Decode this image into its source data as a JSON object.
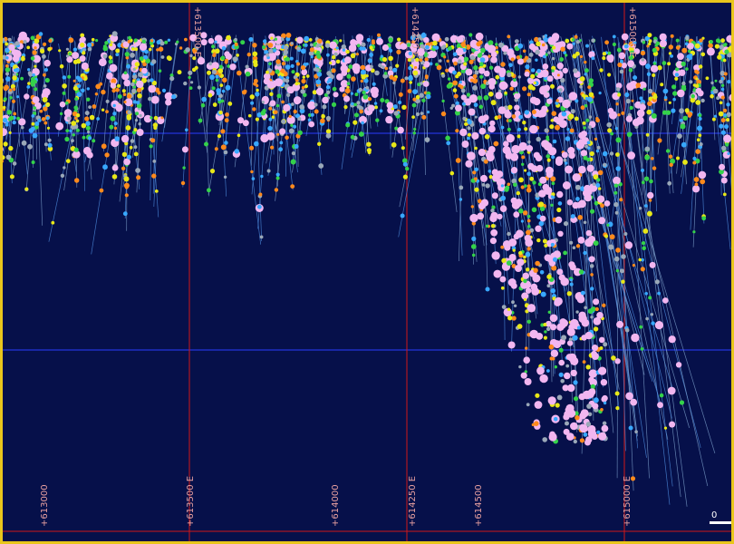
{
  "section_view": {
    "background_color": "#06104a",
    "frame_color": "#e9c61c",
    "gridline_color": "#d01818",
    "level_line_color": "#2a3cff",
    "grid_labels_top": [
      "+613500 E",
      "+614250 E",
      "+615000 E"
    ],
    "grid_labels_bottom": [
      "+613000",
      "+613500 E",
      "+614000",
      "+614250 E",
      "+614500",
      "+615000 E"
    ],
    "scale_bar_label": "0",
    "sample_marker_colors": [
      "#f2b6f0",
      "#ff8a1c",
      "#e8e818",
      "#34d24a",
      "#38a8ff",
      "#9aa8b8"
    ]
  }
}
